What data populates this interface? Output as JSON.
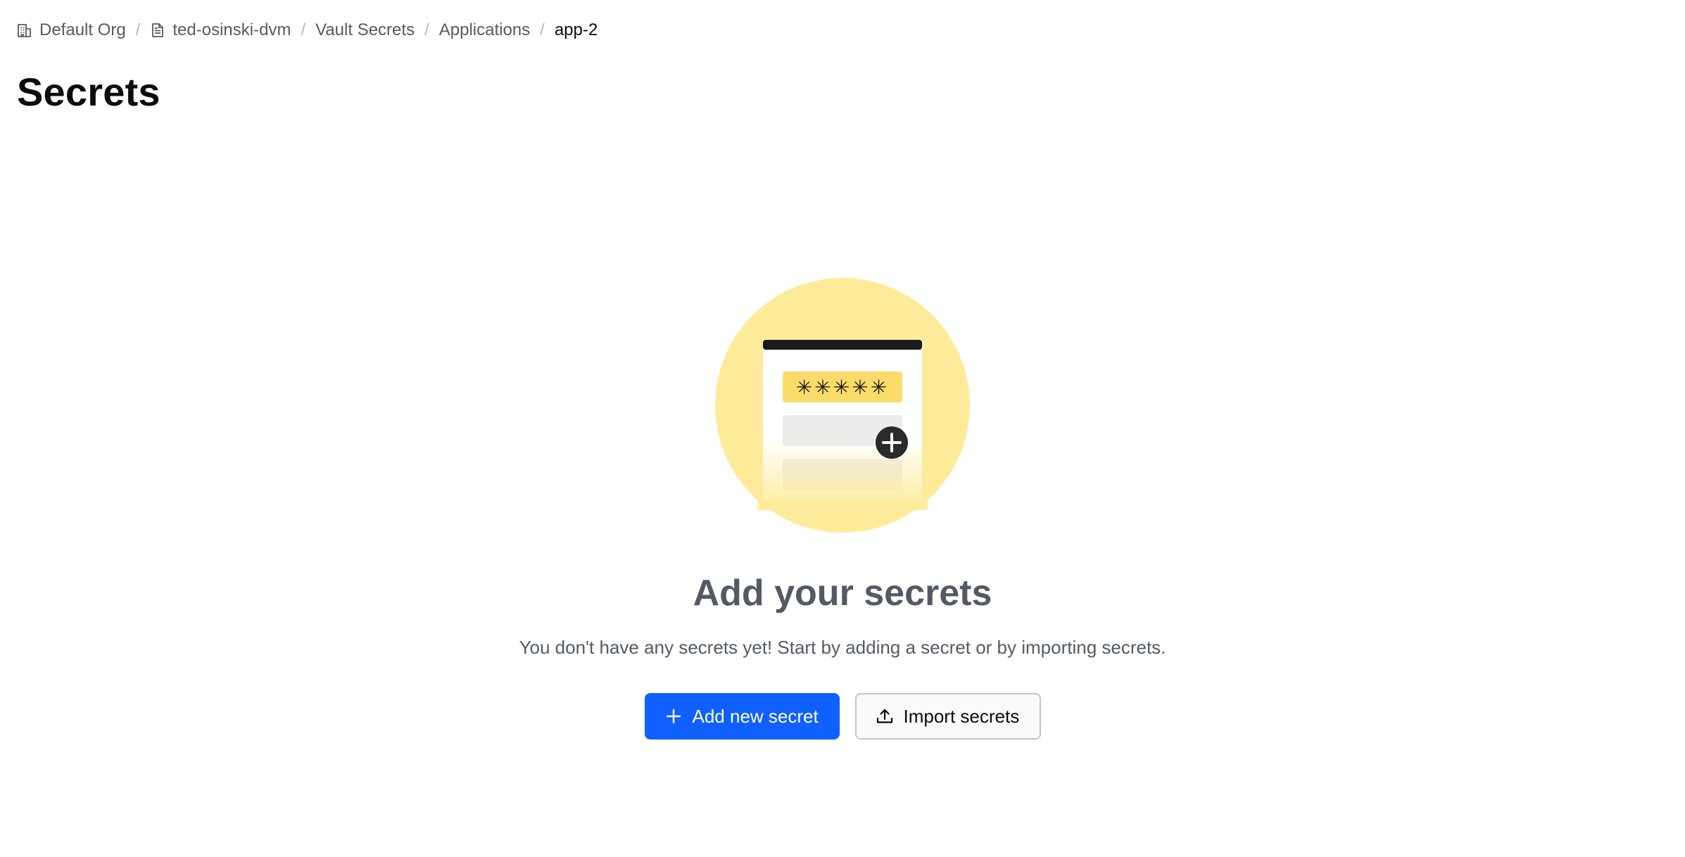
{
  "breadcrumb": {
    "items": [
      {
        "label": "Default Org",
        "icon": "building-icon"
      },
      {
        "label": "ted-osinski-dvm",
        "icon": "file-text-icon"
      },
      {
        "label": "Vault Secrets"
      },
      {
        "label": "Applications"
      },
      {
        "label": "app-2"
      }
    ],
    "separator": "/"
  },
  "page": {
    "title": "Secrets"
  },
  "empty_state": {
    "illustration": "secrets-form-illustration",
    "masked_value": "✳✳✳✳✳",
    "title": "Add your secrets",
    "description": "You don't have any secrets yet! Start by adding a secret or by importing secrets."
  },
  "actions": {
    "add_label": "Add new secret",
    "add_icon": "plus-icon",
    "import_label": "Import secrets",
    "import_icon": "upload-icon"
  },
  "colors": {
    "primary": "#1060ff",
    "illustration_circle": "#feeb9a",
    "illustration_field": "#fbdc6a",
    "text_muted": "#545a65",
    "text_strong": "#0c0c0e"
  }
}
